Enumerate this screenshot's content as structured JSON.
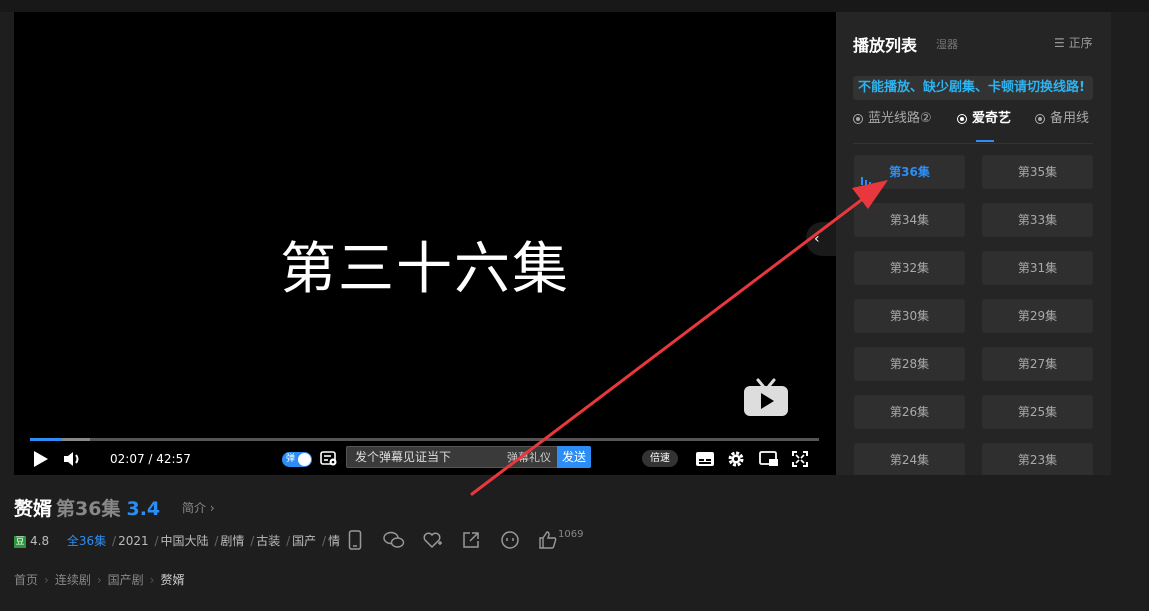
{
  "player": {
    "episode_banner": "第三十六集",
    "current_time": "02:07",
    "total_time": "42:57",
    "progress_fraction": 0.049,
    "danmu_toggle_label": "弹",
    "danmu_placeholder": "发个弹幕见证当下",
    "danmu_etiquette": "弹幕礼仪",
    "send_label": "发送",
    "speed_label": "倍速"
  },
  "playlist": {
    "title": "播放列表",
    "subtitle": "湿器",
    "sort_label": "正序",
    "notice": "不能播放、缺少剧集、卡顿请切换线路!",
    "routes": [
      {
        "label": "蓝光线路②",
        "active": false
      },
      {
        "label": "爱奇艺",
        "active": true
      },
      {
        "label": "备用线",
        "active": false
      }
    ],
    "episodes": [
      "第36集",
      "第35集",
      "第34集",
      "第33集",
      "第32集",
      "第31集",
      "第30集",
      "第29集",
      "第28集",
      "第27集",
      "第26集",
      "第25集",
      "第24集",
      "第23集"
    ],
    "active_episode": "第36集"
  },
  "info": {
    "title": "赘婿",
    "episode": "第36集",
    "score": "3.4",
    "intro_link": "简介 ›",
    "douban_badge": "豆",
    "douban_score": "4.8",
    "all_episodes": "全36集",
    "year": "2021",
    "region": "中国大陆",
    "genres": [
      "剧情",
      "古装",
      "国产",
      "情"
    ],
    "like_count": "1069"
  },
  "breadcrumb": [
    "首页",
    "连续剧",
    "国产剧",
    "赘婿"
  ],
  "colors": {
    "accent": "#2c8ef5",
    "notice_text": "#2cb3f0",
    "annotation_arrow": "#e8383d"
  }
}
